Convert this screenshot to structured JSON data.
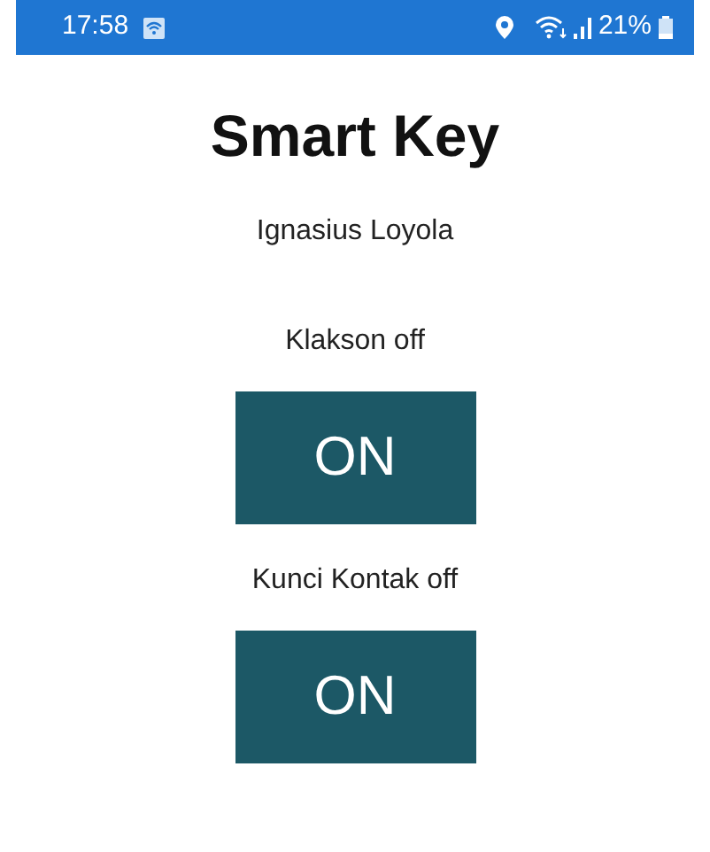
{
  "status_bar": {
    "time": "17:58",
    "battery": "21%"
  },
  "title": "Smart Key",
  "user": "Ignasius Loyola",
  "controls": [
    {
      "label": "Klakson off",
      "button": "ON"
    },
    {
      "label": "Kunci Kontak off",
      "button": "ON"
    }
  ]
}
